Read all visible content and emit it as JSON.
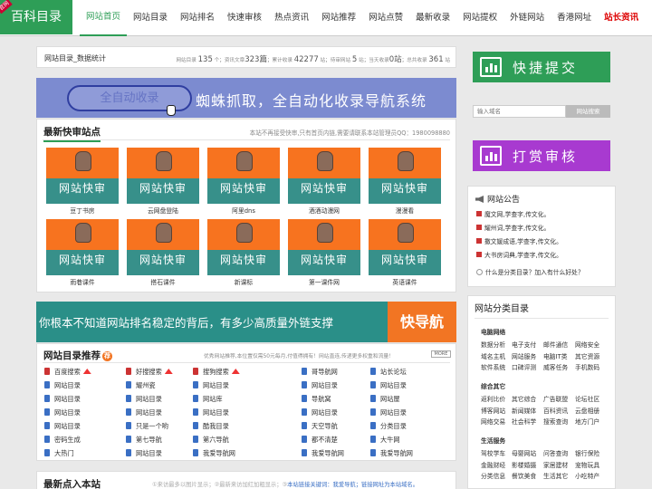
{
  "logo": {
    "text": "百科目录",
    "ribbon": "官网"
  },
  "nav": [
    {
      "label": "网站首页",
      "state": "active"
    },
    {
      "label": "网站目录",
      "state": ""
    },
    {
      "label": "网站排名",
      "state": ""
    },
    {
      "label": "快速审核",
      "state": ""
    },
    {
      "label": "热点资讯",
      "state": ""
    },
    {
      "label": "网站推荐",
      "state": ""
    },
    {
      "label": "网站点赞",
      "state": ""
    },
    {
      "label": "最新收录",
      "state": ""
    },
    {
      "label": "网站提权",
      "state": ""
    },
    {
      "label": "外链网站",
      "state": ""
    },
    {
      "label": "香港网址",
      "state": ""
    },
    {
      "label": "站长资讯",
      "state": "red"
    }
  ],
  "stats": {
    "title": "网站目录_数据统计",
    "s1": "网站目录",
    "v1": "135",
    "u1": "个；资讯文章",
    "v2": "323篇",
    "u2": "；累计收录",
    "v3": "42277",
    "u3": "站；待审网站",
    "v4": "5",
    "u4": "站；当天收录",
    "v5": "0站",
    "u5": "；总共收录",
    "v6": "361",
    "u6": "站"
  },
  "banner1": {
    "pill": "全自动收录",
    "text": "蜘蛛抓取，全自动化收录导航系统"
  },
  "quick": {
    "title": "最新快审站点",
    "note": "本站不再接受快审,只有首页内链,需要请联系本站管理员QQ：1980098880",
    "thumb_label": "网站快审",
    "items": [
      "豆丁书房",
      "云网盘登陆",
      "阿里dns",
      "酒酒动漫网",
      "漫漫看",
      "雨巷课件",
      "搭石课件",
      "新课标",
      "第一课件网",
      "英语课件"
    ]
  },
  "banner2": {
    "text": "你根本不知道网站排名稳定的背后，有多少高质量外链支撑",
    "badge": "快导航"
  },
  "recommend": {
    "title": "网站目录推荐",
    "badge": "荐",
    "note": "优秀网站推荐,本位置仅需50元每月,付值得拥有！网站直连,传递更多权重和流量！",
    "more": "MORE",
    "cols": [
      [
        {
          "t": "百度搜索",
          "hot": true,
          "red": true
        },
        {
          "t": "网站目录"
        },
        {
          "t": "网站目录"
        },
        {
          "t": "网站目录"
        },
        {
          "t": "网站目录"
        },
        {
          "t": "密码生成"
        },
        {
          "t": "大热门"
        }
      ],
      [
        {
          "t": "好搜搜索",
          "hot": true,
          "red": true
        },
        {
          "t": "耀州瓷"
        },
        {
          "t": "网站目录"
        },
        {
          "t": "网站目录"
        },
        {
          "t": "只是一个哟"
        },
        {
          "t": "第七导航"
        },
        {
          "t": "网站目录"
        }
      ],
      [
        {
          "t": "搜狗搜索",
          "hot": true,
          "red": true
        },
        {
          "t": "网站目录"
        },
        {
          "t": "网站库"
        },
        {
          "t": "网站目录"
        },
        {
          "t": "酷我目录"
        },
        {
          "t": "第六导航"
        },
        {
          "t": "我爱导航网"
        }
      ],
      [
        {
          "t": "哥导航网"
        },
        {
          "t": "网站目录"
        },
        {
          "t": "导航窝"
        },
        {
          "t": "网站目录"
        },
        {
          "t": "天空导航"
        },
        {
          "t": "都不清楚"
        },
        {
          "t": "我爱导航网"
        }
      ],
      [
        {
          "t": "站长论坛"
        },
        {
          "t": "网站目录"
        },
        {
          "t": "网站屋"
        },
        {
          "t": "网站目录"
        },
        {
          "t": "分类目录"
        },
        {
          "t": "大牛网"
        },
        {
          "t": "我爱导航网"
        }
      ]
    ]
  },
  "latest": {
    "title": "最新点入本站",
    "note_a": "①来访最多以图片显示；②最新来访加红加粗显示；③",
    "note_b": "本站链接关键词：我爱导航；链接网址为本站域名。"
  },
  "right": {
    "btn1": "快捷提交",
    "search_placeholder": "输入域名",
    "search_button": "网站搜索",
    "btn2": "打赏审核",
    "notice_title": "网站公告",
    "notices": [
      "魔文网,学查字,传文化。",
      "耀州词,学查字,传文化。",
      "撒文媛成语,学查字,传文化。",
      "大书房词典,学查字,传文化。"
    ],
    "faq": "什么是分类目录？加入有什么好处？",
    "cat_title": "网站分类目录",
    "groups": [
      {
        "name": "电脑网络",
        "items": [
          "数据分析",
          "电子支付",
          "邮件通信",
          "网络安全",
          "域名主机",
          "网站服务",
          "电脑IT类",
          "其它资源",
          "软件系统",
          "口碑评测",
          "威客任务",
          "手机数码"
        ]
      },
      {
        "name": "综合其它",
        "items": [
          "返利比价",
          "其它综合",
          "广告联盟",
          "论坛社区",
          "博客网站",
          "新闻媒体",
          "百科资讯",
          "云盘相册",
          "网络交易",
          "社会科学",
          "搜索查询",
          "地方门户"
        ]
      },
      {
        "name": "生活服务",
        "items": [
          "驾校学车",
          "母婴网站",
          "问答查询",
          "银行保险",
          "金融财经",
          "影楼婚摄",
          "家居建材",
          "宠物玩具",
          "分类信息",
          "餐饮美食",
          "生活其它",
          "小吃特产"
        ]
      }
    ]
  },
  "colors": {
    "brand_green": "#2e9e57",
    "orange": "#f27523",
    "teal": "#2a8f88",
    "purple": "#a83ad0",
    "banner_blue": "#7c8bd0"
  }
}
